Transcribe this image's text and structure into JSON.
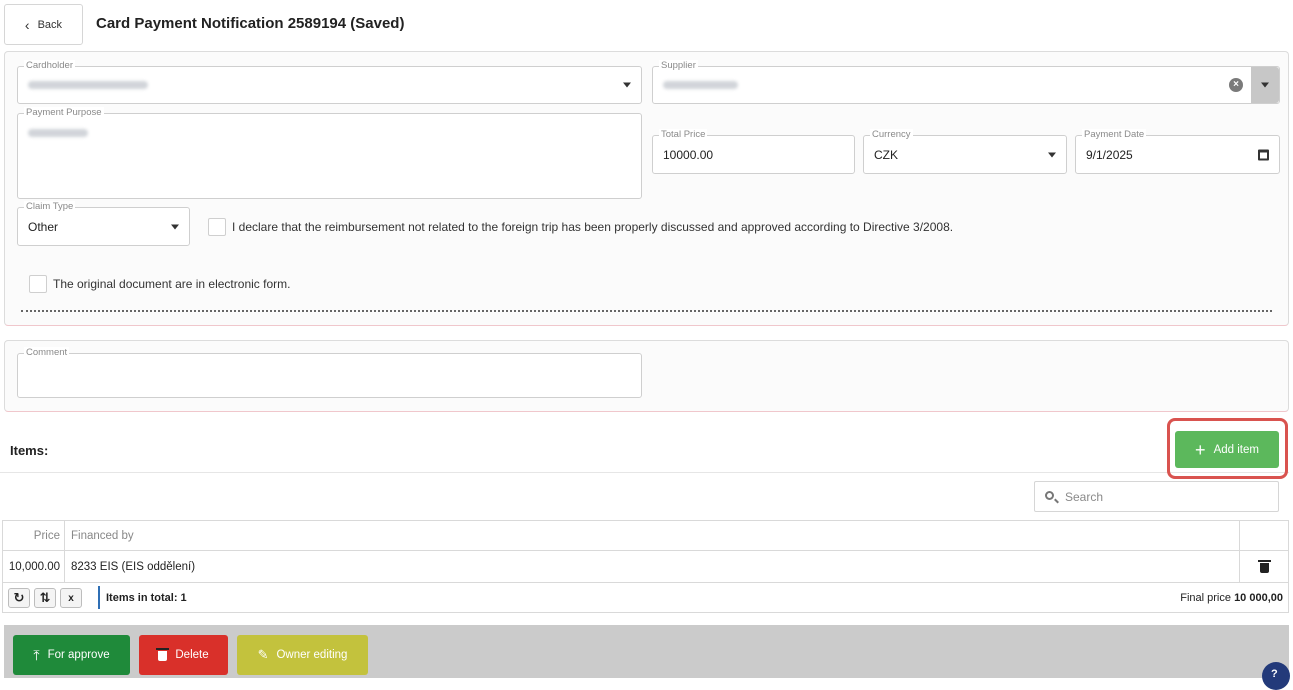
{
  "header": {
    "back_label": "Back",
    "title": "Card Payment Notification 2589194 (Saved)"
  },
  "form": {
    "cardholder_label": "Cardholder",
    "supplier_label": "Supplier",
    "payment_purpose_label": "Payment Purpose",
    "total_price_label": "Total Price",
    "total_price_value": "10000.00",
    "currency_label": "Currency",
    "currency_value": "CZK",
    "payment_date_label": "Payment Date",
    "payment_date_value": "9/1/2025",
    "claim_type_label": "Claim Type",
    "claim_type_value": "Other",
    "declaration_text": "I declare that the reimbursement not related to the foreign trip has been properly discussed and approved according to Directive 3/2008.",
    "electronic_text": "The original document are in electronic form.",
    "comment_label": "Comment"
  },
  "items": {
    "title": "Items:",
    "add_label": "Add item",
    "search_placeholder": "Search",
    "columns": {
      "price": "Price",
      "financed_by": "Financed by"
    },
    "rows": [
      {
        "price": "10,000.00",
        "financed_by": "8233 EIS (EIS oddělení)"
      }
    ],
    "total_text": "Items in total: 1",
    "final_label": "Final price",
    "final_value": "10 000,00"
  },
  "actions": {
    "approve": "For approve",
    "delete": "Delete",
    "owner": "Owner editing"
  },
  "colors": {
    "green": "#5cb85c",
    "dark_green": "#1f8a3a",
    "red": "#d9302a",
    "olive": "#c3c23d",
    "highlight": "#d9534f"
  }
}
